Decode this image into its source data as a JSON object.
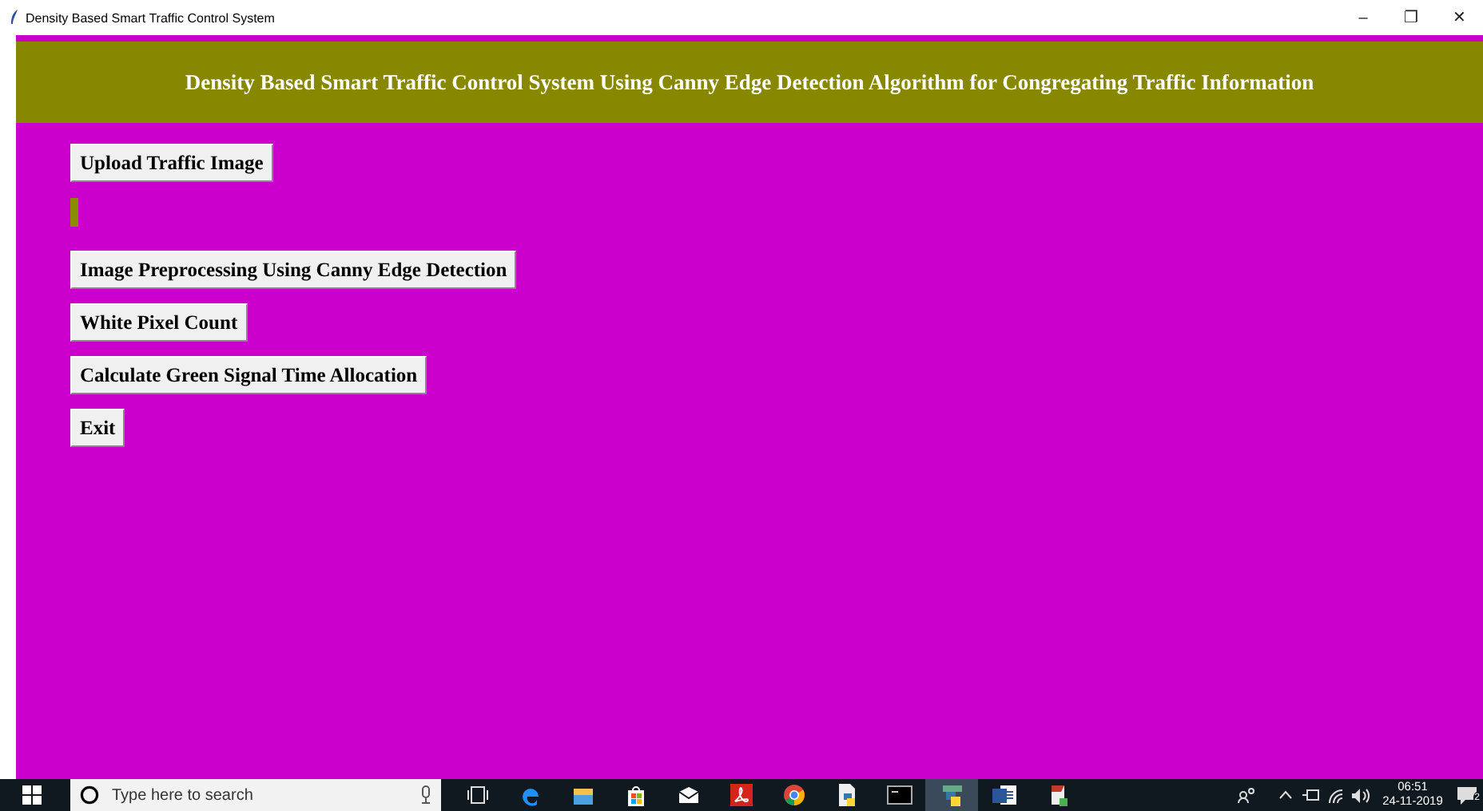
{
  "window": {
    "title": "Density Based Smart Traffic Control System",
    "controls": [
      "–",
      "❐",
      "✕"
    ]
  },
  "header": {
    "title": "Density Based Smart Traffic Control System Using Canny Edge Detection Algorithm for Congregating Traffic Information"
  },
  "controls": [
    {
      "kind": "button",
      "label": "Upload Traffic Image"
    },
    {
      "kind": "label"
    },
    {
      "kind": "button",
      "label": "Image Preprocessing Using Canny Edge Detection"
    },
    {
      "kind": "button",
      "label": "White Pixel Count"
    },
    {
      "kind": "button",
      "label": "Calculate Green Signal Time Allocation"
    },
    {
      "kind": "button",
      "label": "Exit"
    }
  ],
  "taskbar": {
    "search": {
      "placeholder": "Type here to search"
    },
    "time": "06:51",
    "date": "24-11-2019",
    "notification_count": "2"
  }
}
